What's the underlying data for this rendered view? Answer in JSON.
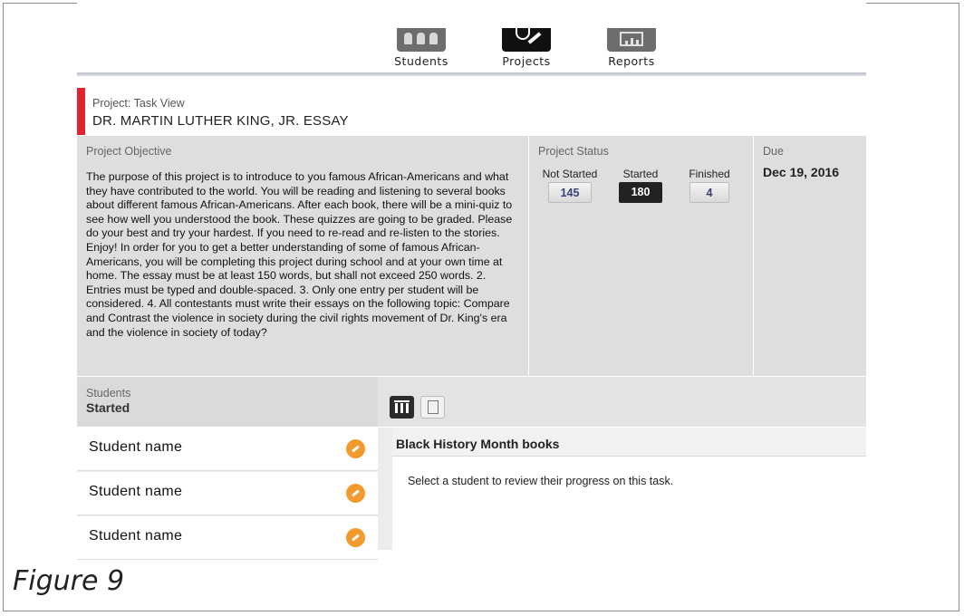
{
  "nav": {
    "items": [
      {
        "label": "Students",
        "icon": "students-icon"
      },
      {
        "label": "Projects",
        "icon": "projects-icon",
        "active": true
      },
      {
        "label": "Reports",
        "icon": "reports-icon"
      }
    ]
  },
  "header": {
    "subtitle": "Project: Task View",
    "title": "DR. MARTIN LUTHER KING, JR. ESSAY",
    "accent_color": "#e3232b"
  },
  "objective": {
    "title": "Project Objective",
    "text": "The purpose of this project is to introduce to you famous African-Americans and what they have contributed to the world. You will be reading and listening to several books about different famous African-Americans. After each book, there will be a mini-quiz to see how well you understood the book. These quizzes are going to be graded. Please do your best and try your hardest. If you need to re-read and re-listen to the stories. Enjoy! In order for you to get a better understanding of some of famous African-Americans, you will be completing this project during school and at your own time at home. The essay must be at least 150 words, but shall not exceed 250 words. 2. Entries must be typed and double-spaced. 3. Only one entry per student will be considered. 4. All contestants must write their essays on the following topic: Compare and Contrast the violence in society during the civil rights movement of Dr. King's era and the violence in society of today?"
  },
  "status": {
    "title": "Project Status",
    "not_started_label": "Not Started",
    "not_started_value": "145",
    "started_label": "Started",
    "started_value": "180",
    "finished_label": "Finished",
    "finished_value": "4"
  },
  "due": {
    "title": "Due",
    "date": "Dec 19, 2016"
  },
  "students": {
    "label": "Students",
    "filter": "Started",
    "rows": [
      {
        "name": "Student name"
      },
      {
        "name": "Student name"
      },
      {
        "name": "Student name"
      }
    ]
  },
  "content": {
    "title": "Black History Month books",
    "message": "Select a student to review their progress on this task."
  },
  "caption": "Figure 9"
}
